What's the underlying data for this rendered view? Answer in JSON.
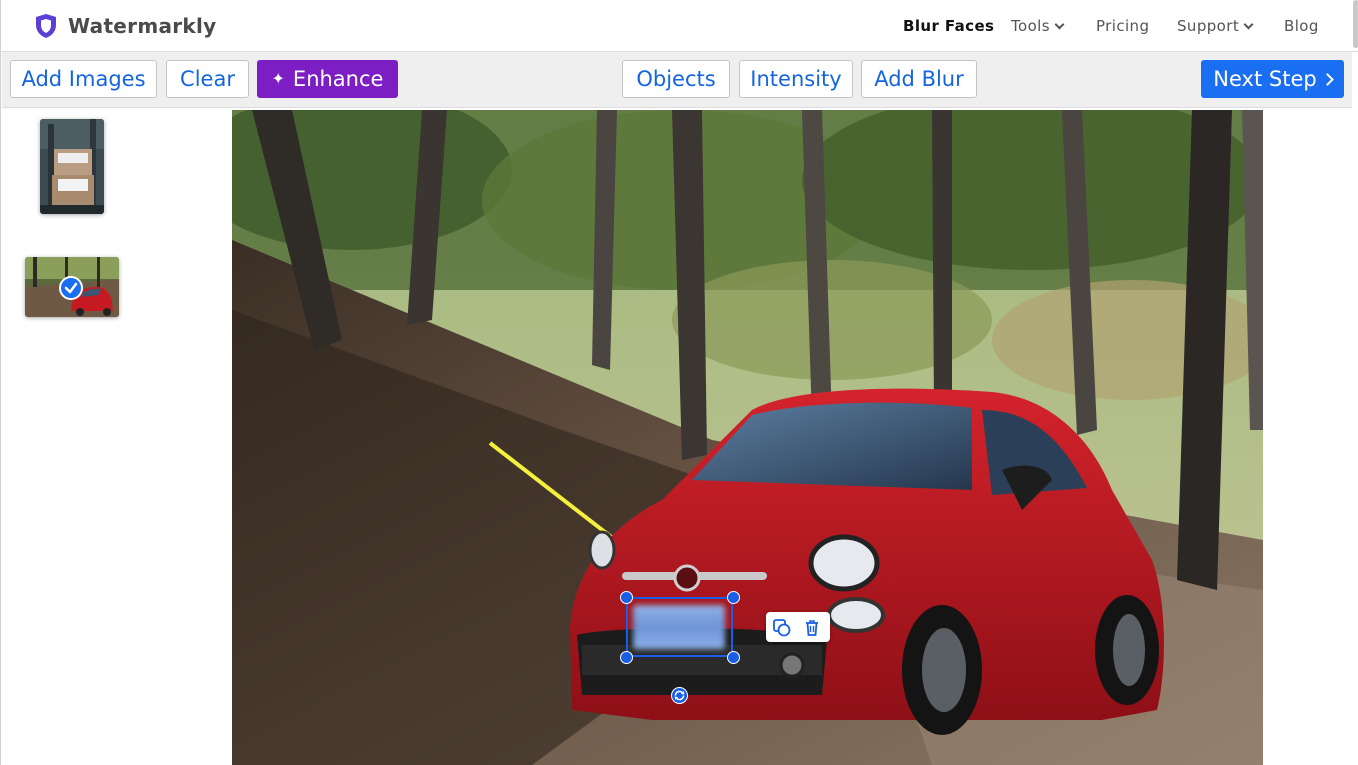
{
  "brand": {
    "name": "Watermarkly"
  },
  "nav": {
    "blur_faces": "Blur Faces",
    "tools": "Tools",
    "pricing": "Pricing",
    "support": "Support",
    "blog": "Blog"
  },
  "toolbar": {
    "add_images": "Add Images",
    "clear": "Clear",
    "enhance": "Enhance",
    "objects": "Objects",
    "intensity": "Intensity",
    "add_blur": "Add Blur",
    "next_step": "Next Step"
  },
  "thumbnails": [
    {
      "name": "boxes-photo",
      "selected": false
    },
    {
      "name": "red-car-photo",
      "selected": true
    }
  ],
  "colors": {
    "accent_blue": "#1a6ef2",
    "enhance_purple": "#7c1ec4",
    "link_blue": "#1565e0",
    "arrow_yellow": "#f4f03c"
  },
  "icons": {
    "logo": "shield-icon",
    "check": "check-icon",
    "duplicate": "duplicate-icon",
    "delete": "trash-icon",
    "rotate": "rotate-icon",
    "enhance": "sparkle-icon"
  }
}
